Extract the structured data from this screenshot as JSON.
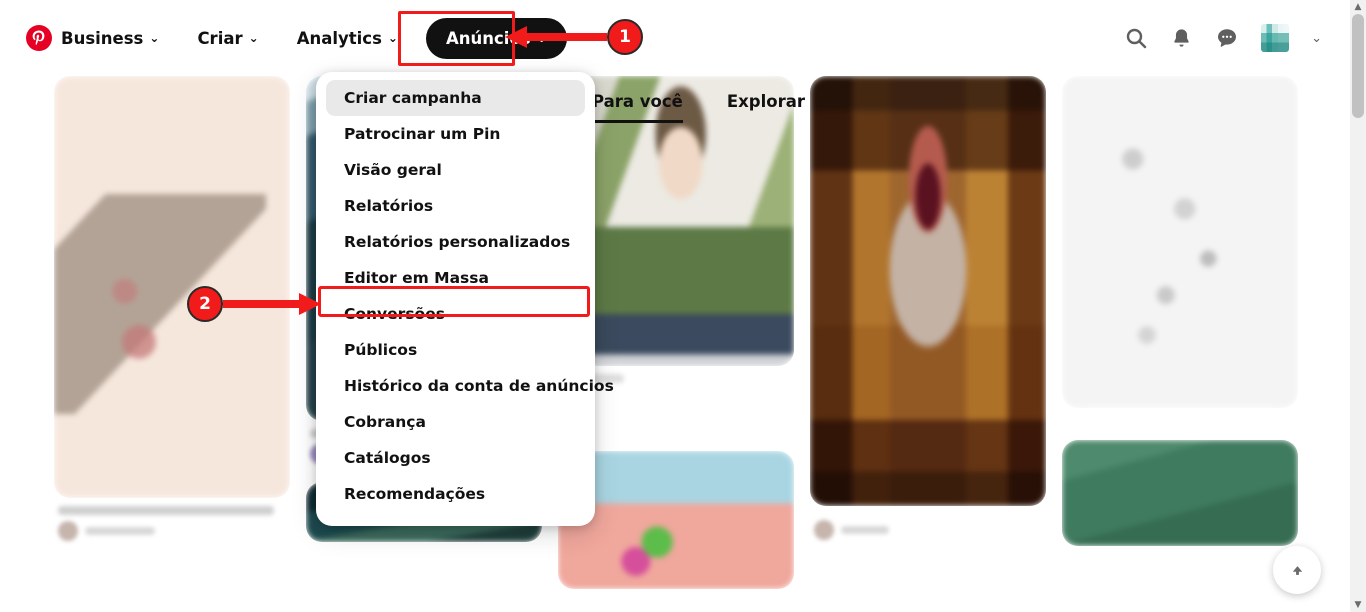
{
  "header": {
    "brand": {
      "name": "Business",
      "logo_icon": "pinterest-logo-icon",
      "chevron": "⌄"
    },
    "nav": [
      {
        "label": "Criar",
        "chevron": "⌄",
        "active": false
      },
      {
        "label": "Analytics",
        "chevron": "⌄",
        "active": false
      },
      {
        "label": "Anúncios",
        "chevron": "⌄",
        "active": true
      }
    ],
    "right_icons": [
      {
        "name": "search-icon"
      },
      {
        "name": "notifications-bell-icon"
      },
      {
        "name": "messages-icon"
      },
      {
        "name": "account-avatar"
      },
      {
        "name": "account-chevron-down-icon",
        "glyph": "⌄"
      }
    ]
  },
  "tabs": [
    {
      "label": "Para você",
      "active": true
    },
    {
      "label": "Explorar",
      "active": false
    }
  ],
  "dropdown": {
    "items": [
      {
        "label": "Criar campanha",
        "state": "hover"
      },
      {
        "label": "Patrocinar um Pin",
        "state": "normal"
      },
      {
        "label": "Visão geral",
        "state": "normal"
      },
      {
        "label": "Relatórios",
        "state": "normal"
      },
      {
        "label": "Relatórios personalizados",
        "state": "normal"
      },
      {
        "label": "Editor em Massa",
        "state": "normal"
      },
      {
        "label": "Conversões",
        "state": "highlighted"
      },
      {
        "label": "Públicos",
        "state": "normal"
      },
      {
        "label": "Histórico da conta de anúncios",
        "state": "normal"
      },
      {
        "label": "Cobrança",
        "state": "normal"
      },
      {
        "label": "Catálogos",
        "state": "normal"
      },
      {
        "label": "Recomendações",
        "state": "normal"
      }
    ]
  },
  "annotations": {
    "badges": [
      {
        "number": "1",
        "target": "Anúncios"
      },
      {
        "number": "2",
        "target": "Conversões"
      }
    ],
    "highlight_color": "#f21b1b"
  },
  "fab": {
    "name": "scroll-to-top-button",
    "glyph": "▲"
  },
  "scrollbar": {
    "up_glyph": "▲",
    "down_glyph": "▼"
  },
  "colors": {
    "brand_red": "#e60023",
    "annotation_red": "#f21b1b",
    "active_pill": "#111111",
    "hover_gray": "#e9e9e9"
  }
}
